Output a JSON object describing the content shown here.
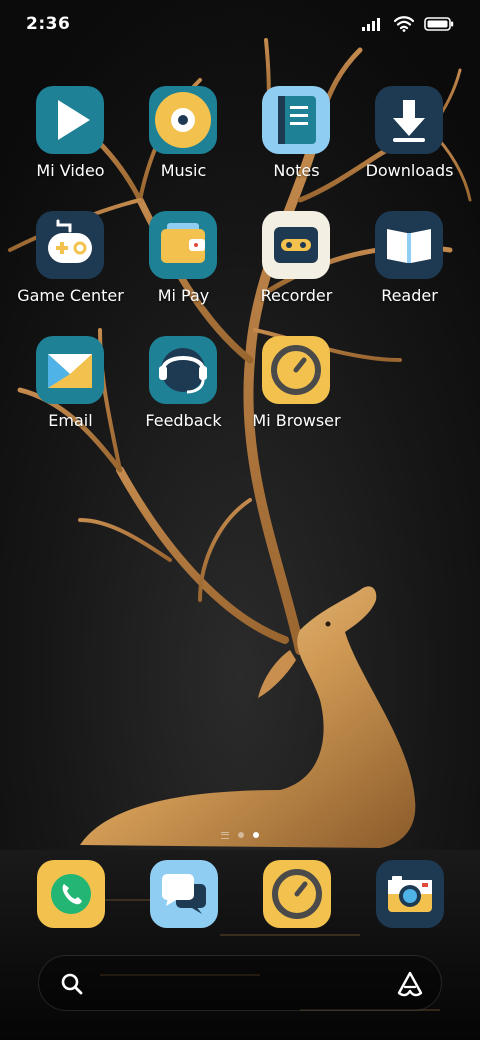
{
  "status_bar": {
    "time": "2:36"
  },
  "apps": [
    {
      "label": "Mi Video",
      "icon": "play-icon"
    },
    {
      "label": "Music",
      "icon": "music-disc-icon"
    },
    {
      "label": "Notes",
      "icon": "notes-icon"
    },
    {
      "label": "Downloads",
      "icon": "download-arrow-icon"
    },
    {
      "label": "Game Center",
      "icon": "gamepad-icon"
    },
    {
      "label": "Mi Pay",
      "icon": "wallet-icon"
    },
    {
      "label": "Recorder",
      "icon": "cassette-icon"
    },
    {
      "label": "Reader",
      "icon": "open-book-icon"
    },
    {
      "label": "Email",
      "icon": "envelope-icon"
    },
    {
      "label": "Feedback",
      "icon": "headset-icon"
    },
    {
      "label": "Mi Browser",
      "icon": "compass-icon"
    }
  ],
  "pages": {
    "count": 2,
    "active": 2
  },
  "dock": [
    {
      "icon": "phone-icon"
    },
    {
      "icon": "messages-icon"
    },
    {
      "icon": "compass-icon"
    },
    {
      "icon": "camera-icon"
    }
  ],
  "colors": {
    "teal": "#1e8196",
    "navy": "#1e3a52",
    "yellow": "#f2c14e",
    "light_blue": "#8fcdf2",
    "green": "#22b573",
    "cream": "#f4efe3"
  }
}
